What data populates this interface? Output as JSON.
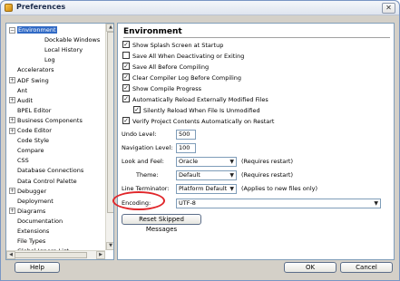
{
  "window": {
    "title": "Preferences",
    "close": "✕"
  },
  "tree": {
    "items": [
      {
        "label": "Environment",
        "expander": "−",
        "selected": true
      },
      {
        "label": "Dockable Windows"
      },
      {
        "label": "Local History"
      },
      {
        "label": "Log"
      },
      {
        "label": "Accelerators"
      },
      {
        "label": "ADF Swing",
        "expander": "+"
      },
      {
        "label": "Ant"
      },
      {
        "label": "Audit",
        "expander": "+"
      },
      {
        "label": "BPEL Editor"
      },
      {
        "label": "Business Components",
        "expander": "+"
      },
      {
        "label": "Code Editor",
        "expander": "+"
      },
      {
        "label": "Code Style"
      },
      {
        "label": "Compare"
      },
      {
        "label": "CSS"
      },
      {
        "label": "Database Connections"
      },
      {
        "label": "Data Control Palette"
      },
      {
        "label": "Debugger",
        "expander": "+"
      },
      {
        "label": "Deployment"
      },
      {
        "label": "Diagrams",
        "expander": "+"
      },
      {
        "label": "Documentation"
      },
      {
        "label": "Extensions"
      },
      {
        "label": "File Types"
      },
      {
        "label": "Global Ignore List"
      }
    ],
    "scroll_up": "▲",
    "scroll_down": "▼",
    "scroll_left": "◀",
    "scroll_right": "▶"
  },
  "main": {
    "title": "Environment",
    "checkboxes": [
      {
        "label": "Show Splash Screen at Startup",
        "checked": true,
        "mark": "✓"
      },
      {
        "label": "Save All When Deactivating or Exiting",
        "checked": false,
        "mark": ""
      },
      {
        "label": "Save All Before Compiling",
        "checked": true,
        "mark": "✓"
      },
      {
        "label": "Clear Compiler Log Before Compiling",
        "checked": true,
        "mark": "✓"
      },
      {
        "label": "Show Compile Progress",
        "checked": true,
        "mark": "✓"
      },
      {
        "label": "Automatically Reload Externally Modified Files",
        "checked": true,
        "mark": "✓"
      },
      {
        "label": "Silently Reload When File Is Unmodified",
        "checked": true,
        "mark": "✓"
      },
      {
        "label": "Verify Project Contents Automatically on Restart",
        "checked": true,
        "mark": "✓"
      }
    ],
    "undo_level": {
      "label": "Undo Level:",
      "value": "500"
    },
    "navigation_level": {
      "label": "Navigation Level:",
      "value": "100"
    },
    "look_and_feel": {
      "label": "Look and Feel:",
      "value": "Oracle",
      "note": "(Requires restart)"
    },
    "theme": {
      "label": "Theme:",
      "value": "Default",
      "note": "(Requires restart)"
    },
    "line_terminator": {
      "label": "Line Terminator:",
      "value": "Platform Default",
      "note": "(Applies to new files only)"
    },
    "encoding": {
      "label": "Encoding:",
      "value": "UTF-8"
    },
    "reset_button": "Reset Skipped Messages",
    "dropdown_arrow": "▼"
  },
  "footer": {
    "help": "Help",
    "ok": "OK",
    "cancel": "Cancel"
  },
  "colors": {
    "selection": "#316ac5",
    "highlight_ellipse": "#e0262a"
  }
}
